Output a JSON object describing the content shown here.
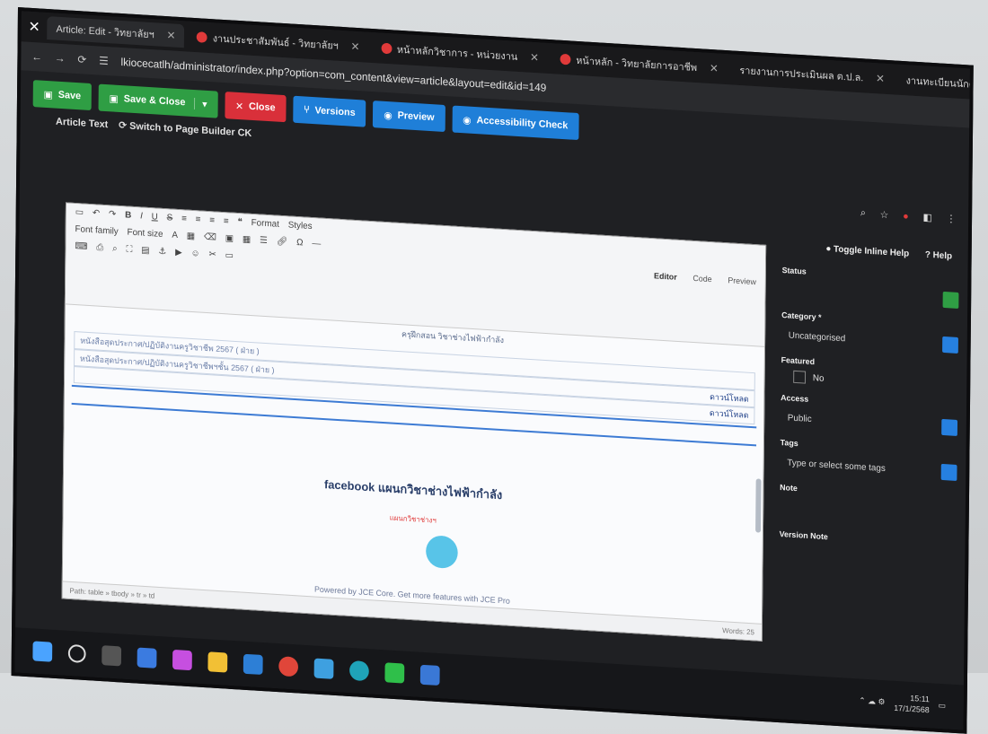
{
  "browser": {
    "tabs": [
      {
        "label": "Article: Edit - วิทยาลัยฯ",
        "active": true
      },
      {
        "label": "งานประชาสัมพันธ์ - วิทยาลัยฯ"
      },
      {
        "label": "หน้าหลักวิชาการ - หน่วยงาน"
      },
      {
        "label": "หน้าหลัก - วิทยาลัยการอาชีพ"
      },
      {
        "label": "รายงานการประเมินผล ต.ป.ล."
      },
      {
        "label": "งานทะเบียนนักศึกษา"
      }
    ],
    "url": "lkiocecatlh/administrator/index.php?option=com_content&view=article&layout=edit&id=149"
  },
  "toolbar": {
    "save_label": "Save",
    "save_close_label": "Save & Close",
    "close_label": "Close",
    "versions_label": "Versions",
    "preview_label": "Preview",
    "accessibility_label": "Accessibility Check"
  },
  "subrow": {
    "article_text_label": "Article Text",
    "switch_label": "Switch to Page Builder CK"
  },
  "help": {
    "toggle_label": "Toggle Inline Help",
    "help_label": "Help"
  },
  "editor": {
    "font_family": "Font family",
    "font_size": "Font size",
    "format": "Format",
    "styles": "Styles",
    "view_tabs": [
      "Editor",
      "Code",
      "Preview"
    ],
    "header_cell": "ครุฝึกสอน วิชาช่างไฟฟ้ากำลัง",
    "rows": [
      {
        "text": "หนังสือสุดประกาศ/ปฏิบัติงานครูวิชาชีพ 2567 ( ฝ่าย )",
        "link": ""
      },
      {
        "text": "หนังสือสุดประกาศ/ปฏิบัติงานครูวิชาชีพฯชั้น 2567 ( ฝ่าย )",
        "link": "ดาวน์โหลด"
      },
      {
        "text": "",
        "link": "ดาวน์โหลด"
      }
    ],
    "facebook_title": "facebook แผนกวิชาช่างไฟฟ้ากำลัง",
    "small_link": "แผนกวิชาช่างฯ",
    "powered": "Powered by JCE Core. Get more features with JCE Pro",
    "status_path": "Path: table » tbody » tr » td",
    "word_count": "Words: 25"
  },
  "sidebar": {
    "status_label": "Status",
    "category_label": "Category *",
    "category_value": "Uncategorised",
    "featured_label": "Featured",
    "featured_value": "No",
    "access_label": "Access",
    "access_value": "Public",
    "tags_label": "Tags",
    "tags_placeholder": "Type or select some tags",
    "note_label": "Note",
    "version_note_label": "Version Note"
  },
  "tray": {
    "time": "15:11",
    "date": "17/1/2568"
  },
  "colors": {
    "save_green": "#2f9e44",
    "close_red": "#d9303a",
    "action_blue": "#1f7fd8",
    "screen_bg": "#1f2023"
  }
}
